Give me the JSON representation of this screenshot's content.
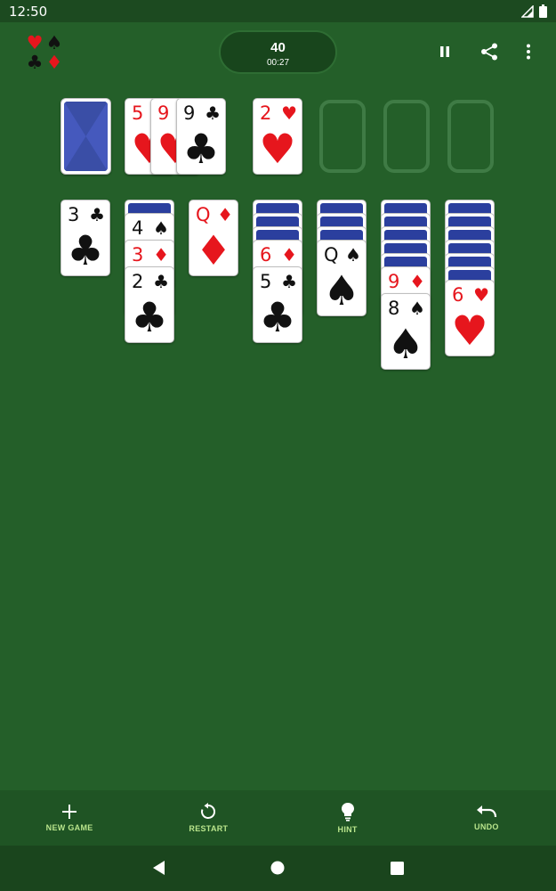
{
  "status_bar": {
    "time": "12:50",
    "icons": [
      "signal-icon",
      "battery-icon"
    ]
  },
  "header": {
    "logo_suits": [
      "♥",
      "♠",
      "♣",
      "♦"
    ],
    "score": "40",
    "timer": "00:27",
    "icons": [
      "pause-icon",
      "share-icon",
      "more-vert-icon"
    ]
  },
  "colors": {
    "felt": "#245f29",
    "red_suit": "#e6161d",
    "black_suit": "#111111",
    "card_back": "#2b3f9e",
    "accent": "#b9e58c"
  },
  "waste": [
    {
      "rank": "5",
      "suit": "♥",
      "color": "red"
    },
    {
      "rank": "9",
      "suit": "♥",
      "color": "red"
    },
    {
      "rank": "9",
      "suit": "♣",
      "color": "black"
    }
  ],
  "foundations": [
    {
      "rank": "2",
      "suit": "♥",
      "color": "red"
    }
  ],
  "tableau": [
    {
      "hidden": 0,
      "cards": [
        {
          "rank": "3",
          "suit": "♣",
          "color": "black"
        }
      ]
    },
    {
      "hidden": 1,
      "cards": [
        {
          "rank": "4",
          "suit": "♠",
          "color": "black"
        },
        {
          "rank": "3",
          "suit": "♦",
          "color": "red"
        },
        {
          "rank": "2",
          "suit": "♣",
          "color": "black"
        }
      ]
    },
    {
      "hidden": 0,
      "cards": [
        {
          "rank": "Q",
          "suit": "♦",
          "color": "red"
        }
      ]
    },
    {
      "hidden": 3,
      "cards": [
        {
          "rank": "6",
          "suit": "♦",
          "color": "red"
        },
        {
          "rank": "5",
          "suit": "♣",
          "color": "black"
        }
      ]
    },
    {
      "hidden": 3,
      "cards": [
        {
          "rank": "Q",
          "suit": "♠",
          "color": "black"
        }
      ]
    },
    {
      "hidden": 5,
      "cards": [
        {
          "rank": "9",
          "suit": "♦",
          "color": "red"
        },
        {
          "rank": "8",
          "suit": "♠",
          "color": "black"
        }
      ]
    },
    {
      "hidden": 6,
      "cards": [
        {
          "rank": "6",
          "suit": "♥",
          "color": "red"
        }
      ]
    }
  ],
  "toolbar": {
    "new_game": "NEW GAME",
    "restart": "RESTART",
    "hint": "HINT",
    "undo": "UNDO"
  }
}
